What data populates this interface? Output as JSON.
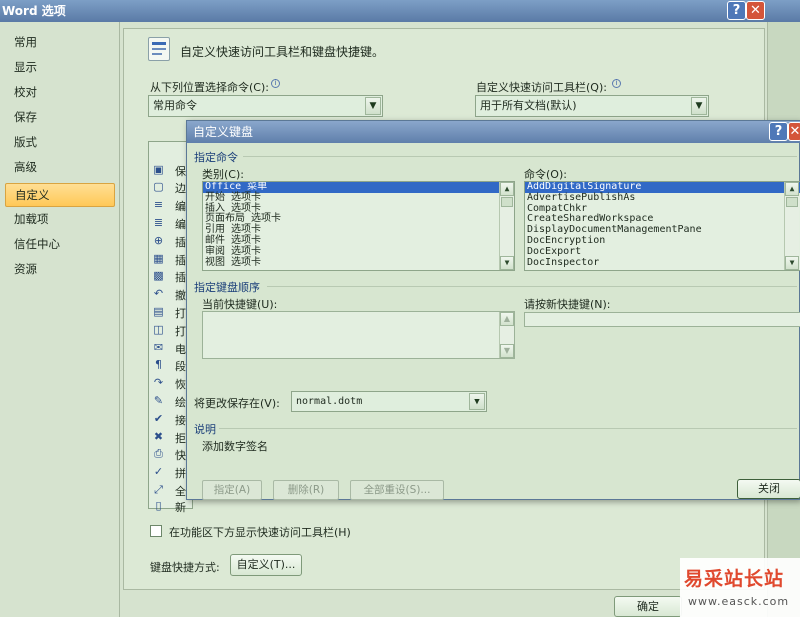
{
  "window": {
    "title": "Word 选项",
    "help_icon": "?",
    "close_icon": "✕"
  },
  "nav": {
    "items": [
      "常用",
      "显示",
      "校对",
      "保存",
      "版式",
      "高级",
      "自定义",
      "加载项",
      "信任中心",
      "资源"
    ],
    "active": "自定义"
  },
  "customize": {
    "header": "自定义快速访问工具栏和键盘快捷键。",
    "choose_from_label": "从下列位置选择命令(C):",
    "choose_from_value": "常用命令",
    "qat_label": "自定义快速访问工具栏(Q):",
    "qat_value": "用于所有文档(默认)",
    "command_chars": [
      "保",
      "边",
      "编",
      "编",
      "插",
      "插",
      "插",
      "撤",
      "打",
      "打",
      "电",
      "段",
      "恢",
      "绘",
      "接",
      "拒",
      "快",
      "拼",
      "全",
      "新"
    ],
    "show_below_ribbon_label": "在功能区下方显示快速访问工具栏(H)",
    "keyboard_shortcuts_label": "键盘快捷方式:",
    "customize_button": "自定义(T)...",
    "ok_button": "确定"
  },
  "dialog": {
    "title": "自定义键盘",
    "specify_command_section": "指定命令",
    "categories_label": "类别(C):",
    "categories": [
      "Office 菜单",
      "开始 选项卡",
      "插入 选项卡",
      "页面布局 选项卡",
      "引用 选项卡",
      "邮件 选项卡",
      "审阅 选项卡",
      "视图 选项卡"
    ],
    "selected_category": "Office 菜单",
    "commands_label": "命令(O):",
    "commands": [
      "AddDigitalSignature",
      "AdvertisePublishAs",
      "CompatChkr",
      "CreateSharedWorkspace",
      "DisplayDocumentManagementPane",
      "DocEncryption",
      "DocExport",
      "DocInspector"
    ],
    "selected_command": "AddDigitalSignature",
    "key_sequence_section": "指定键盘顺序",
    "current_keys_label": "当前快捷键(U):",
    "new_key_label": "请按新快捷键(N):",
    "save_in_label": "将更改保存在(V):",
    "save_in_value": "normal.dotm",
    "description_section": "说明",
    "description_text": "添加数字签名",
    "assign_button": "指定(A)",
    "remove_button": "删除(R)",
    "reset_all_button": "全部重设(S)...",
    "close_button": "关闭"
  },
  "watermark": {
    "title": "易采站长站",
    "url": "www.easck.com"
  }
}
